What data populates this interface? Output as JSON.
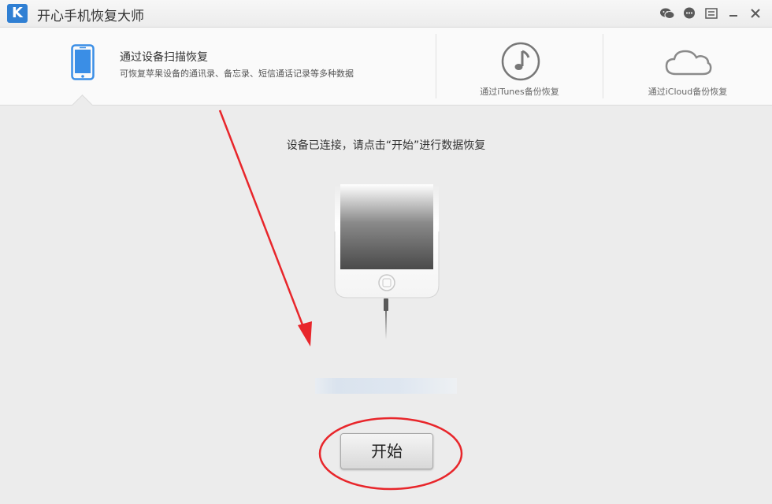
{
  "window": {
    "title": "开心手机恢复大师",
    "logo_letter": "K",
    "controls": [
      "wechat-icon",
      "chat-icon",
      "menu-icon",
      "minimize-icon",
      "close-icon"
    ]
  },
  "tabs": {
    "scan": {
      "title": "通过设备扫描恢复",
      "description": "可恢复苹果设备的通讯录、备忘录、短信通话记录等多种数据",
      "selected": true
    },
    "itunes": {
      "label": "通过iTunes备份恢复"
    },
    "icloud": {
      "label": "通过iCloud备份恢复"
    }
  },
  "main": {
    "status": "设备已连接，请点击“开始”进行数据恢复",
    "start_button": "开始"
  },
  "colors": {
    "accent_blue": "#3a8ee6",
    "annotation_red": "#e8262b"
  }
}
